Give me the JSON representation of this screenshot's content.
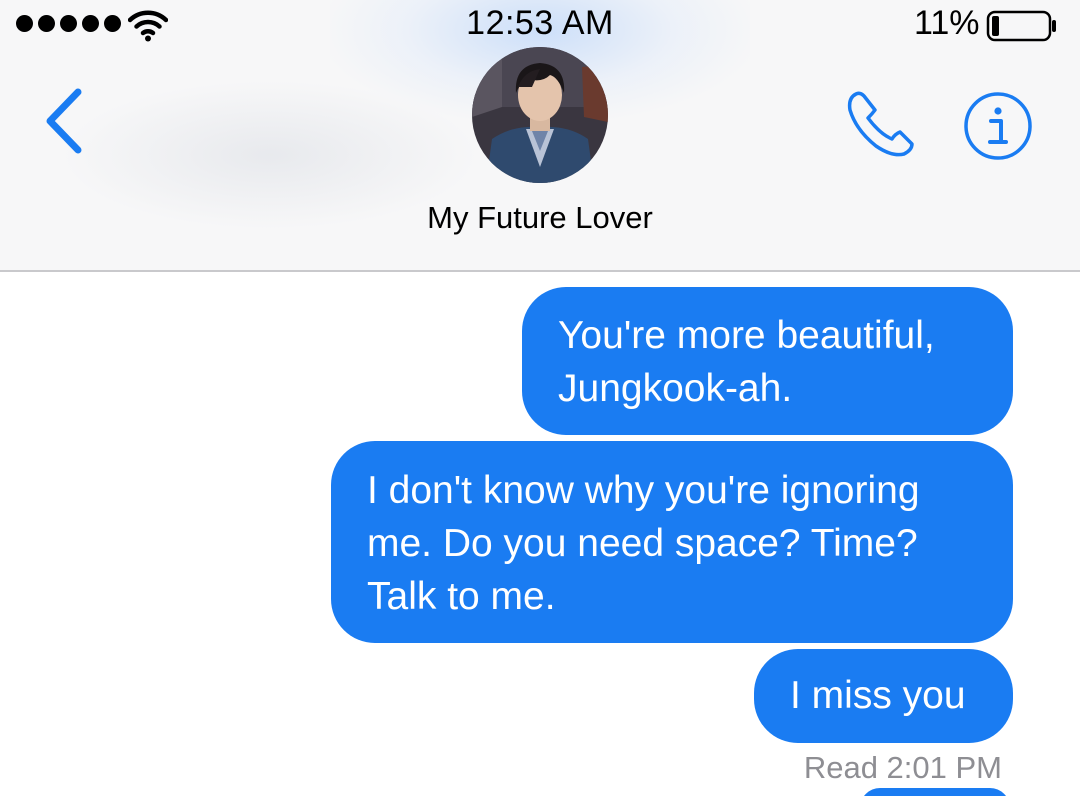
{
  "status_bar": {
    "time": "12:53 AM",
    "battery_percent": "11%",
    "battery_level": 0.11,
    "signal_bars": 5,
    "icons": [
      "signal-dots-icon",
      "wifi-icon",
      "battery-icon"
    ]
  },
  "header": {
    "contact_name": "My Future Lover",
    "icons": [
      "back-chevron-icon",
      "phone-icon",
      "info-icon"
    ],
    "accent_color": "#1a7cf2"
  },
  "messages": [
    {
      "lines": [
        "You're more beautiful,",
        "Jungkook-ah."
      ],
      "sender": "me"
    },
    {
      "lines": [
        "I don't know why you're ignoring",
        "me. Do you need space? Time?",
        "Talk to me."
      ],
      "sender": "me"
    },
    {
      "lines": [
        "I miss you"
      ],
      "sender": "me"
    }
  ],
  "read_receipt": "Read 2:01 PM",
  "colors": {
    "bubble_blue": "#1a7cf2",
    "receipt_gray": "#8e8e93",
    "icon_blue": "#1a7cf2"
  }
}
